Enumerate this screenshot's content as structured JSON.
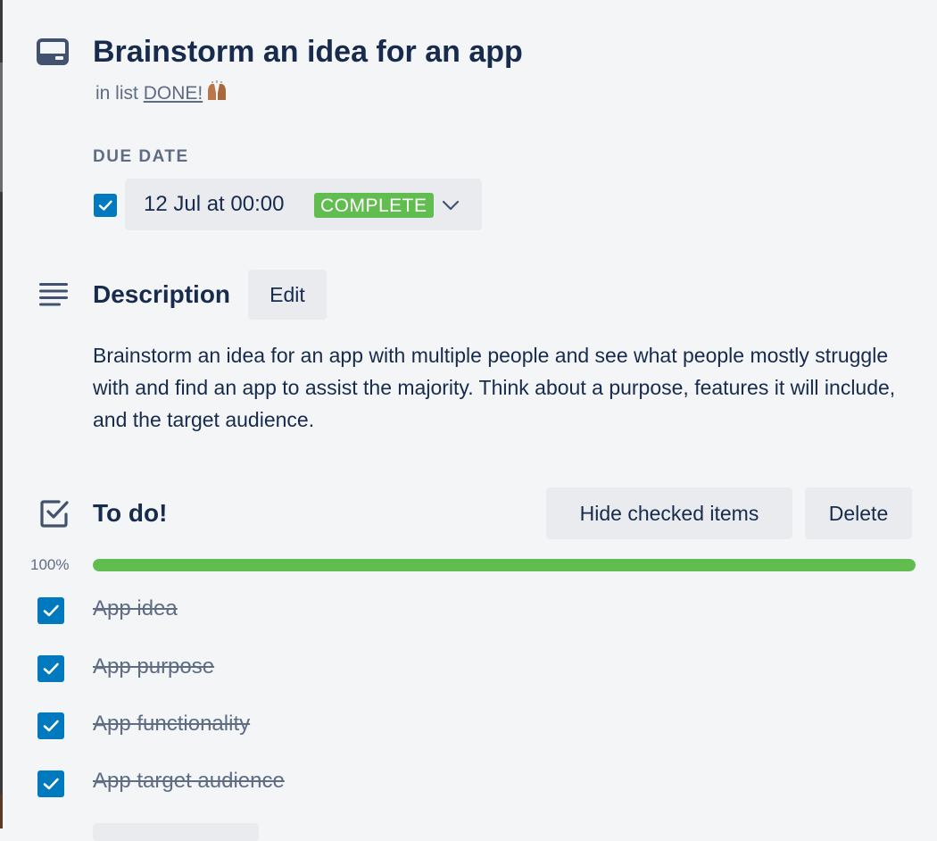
{
  "card": {
    "title": "Brainstorm an idea for an app",
    "list_prefix": "in list",
    "list_name": "DONE!"
  },
  "due_date": {
    "label": "DUE DATE",
    "checked": true,
    "date_text": "12 Jul at 00:00",
    "status": "COMPLETE"
  },
  "description": {
    "heading": "Description",
    "edit_label": "Edit",
    "text": "Brainstorm an idea for an app with multiple people and see what people mostly struggle with and find an app to assist the majority. Think about a purpose, features it will include, and the target audience."
  },
  "checklist": {
    "title": "To do!",
    "hide_checked_label": "Hide checked items",
    "delete_label": "Delete",
    "progress_label": "100%",
    "progress": 1.0,
    "items": [
      {
        "label": "App idea",
        "checked": true
      },
      {
        "label": "App purpose",
        "checked": true
      },
      {
        "label": "App functionality",
        "checked": true
      },
      {
        "label": "App target audience",
        "checked": true
      }
    ]
  },
  "colors": {
    "accent": "#0079bf",
    "complete": "#61bd4f",
    "text": "#172b4d",
    "muted": "#5e6c84",
    "button_bg": "#e9ebef",
    "background": "#f4f5f7"
  },
  "icons": {
    "card": "card-icon",
    "description": "description-icon",
    "checklist": "checklist-icon",
    "check": "check-icon",
    "chevron": "chevron-down-icon",
    "emoji": "raised-hands-emoji"
  }
}
